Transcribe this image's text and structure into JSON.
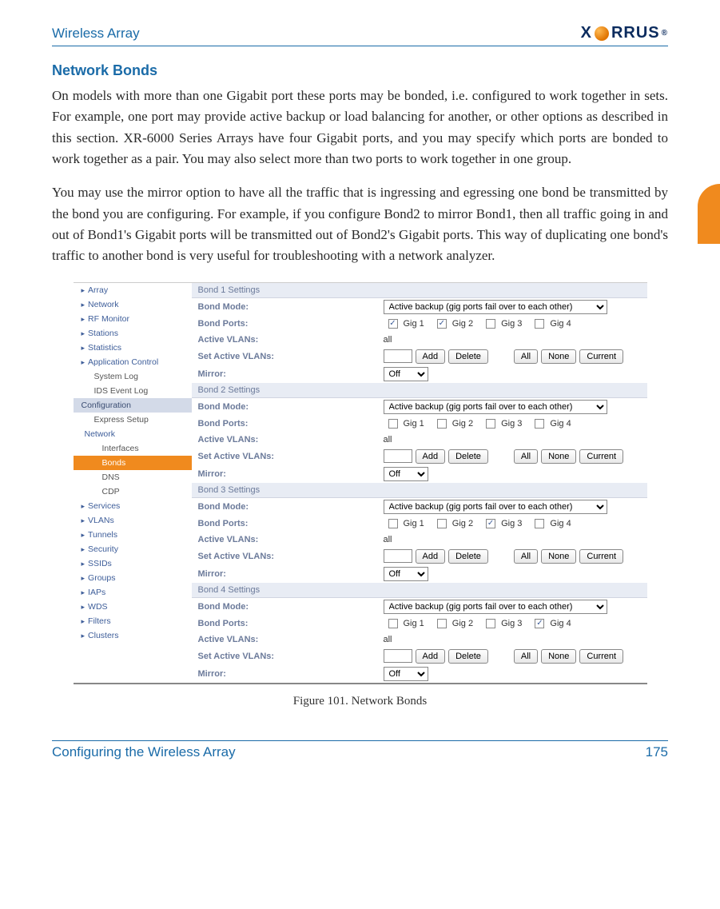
{
  "header": {
    "title": "Wireless Array",
    "brand_left": "X",
    "brand_right": "RRUS"
  },
  "section": {
    "heading": "Network Bonds",
    "p1": "On models with more than one Gigabit port these ports may be bonded, i.e. configured to work together in sets. For example, one port may provide active backup or load balancing for another, or other options as described in this section. XR-6000 Series Arrays have four Gigabit ports, and you may specify which ports are bonded to work together as a pair. You may also select more than two ports to work together in one group.",
    "p2": "You may use the mirror option to have all the traffic that is ingressing and egressing one bond be transmitted by the bond you are configuring. For example, if you configure Bond2 to mirror Bond1, then all traffic going in and out of Bond1's Gigabit ports will be transmitted out of Bond2's Gigabit ports. This way of duplicating one bond's traffic to another bond is very useful for troubleshooting with a network analyzer."
  },
  "sidebar": {
    "groups_top": [
      "Array",
      "Network",
      "RF Monitor",
      "Stations",
      "Statistics",
      "Application Control"
    ],
    "syslog": "System Log",
    "ids": "IDS Event Log",
    "config": "Configuration",
    "express": "Express Setup",
    "network": "Network",
    "interfaces": "Interfaces",
    "bonds": "Bonds",
    "dns": "DNS",
    "cdp": "CDP",
    "groups_bottom": [
      "Services",
      "VLANs",
      "Tunnels",
      "Security",
      "SSIDs",
      "Groups",
      "IAPs",
      "WDS",
      "Filters",
      "Clusters"
    ]
  },
  "labels": {
    "bond_mode": "Bond Mode:",
    "bond_ports": "Bond Ports:",
    "active_vlans": "Active VLANs:",
    "set_active_vlans": "Set Active VLANs:",
    "mirror": "Mirror:"
  },
  "values": {
    "mode": "Active backup (gig ports fail over to each other)",
    "all": "all",
    "off": "Off",
    "gig": [
      "Gig 1",
      "Gig 2",
      "Gig 3",
      "Gig 4"
    ]
  },
  "buttons": {
    "add": "Add",
    "delete": "Delete",
    "all": "All",
    "none": "None",
    "current": "Current"
  },
  "bonds": [
    {
      "title": "Bond 1 Settings",
      "checked": [
        true,
        true,
        false,
        false
      ]
    },
    {
      "title": "Bond 2 Settings",
      "checked": [
        false,
        false,
        false,
        false
      ]
    },
    {
      "title": "Bond 3 Settings",
      "checked": [
        false,
        false,
        true,
        false
      ]
    },
    {
      "title": "Bond 4 Settings",
      "checked": [
        false,
        false,
        false,
        true
      ]
    }
  ],
  "caption": "Figure 101. Network Bonds",
  "footer": {
    "left": "Configuring the Wireless Array",
    "right": "175"
  }
}
